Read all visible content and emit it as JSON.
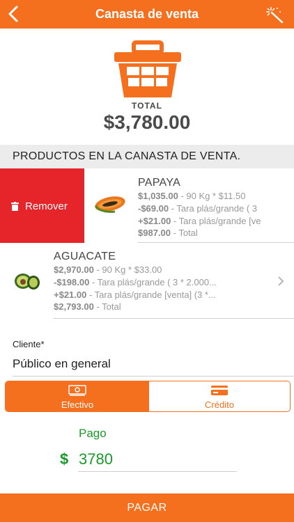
{
  "header": {
    "title": "Canasta de venta",
    "back_icon": "back-arrow-icon",
    "action_icon": "magic-wand-icon"
  },
  "colors": {
    "accent": "#f5701e",
    "danger": "#e6252a",
    "success": "#1a9a2a"
  },
  "summary": {
    "total_label": "TOTAL",
    "total_value": "$3,780.00"
  },
  "section_title": "PRODUCTOS EN LA CANASTA DE VENTA.",
  "products": [
    {
      "name": "PAPAYA",
      "remove_label": "Remover",
      "lines": [
        {
          "amount": "$1,035.00",
          "detail": " - 90 Kg * $11.50"
        },
        {
          "amount": "-$69.00",
          "detail": " - Tara plás/grande ( 3"
        },
        {
          "amount": "+$21.00",
          "detail": " - Tara plás/grande [ve"
        },
        {
          "amount": "$987.00",
          "detail": " - Total"
        }
      ]
    },
    {
      "name": "AGUACATE",
      "lines": [
        {
          "amount": "$2,970.00",
          "detail": " - 90 Kg * $33.00"
        },
        {
          "amount": "-$198.00",
          "detail": " - Tara plás/grande ( 3 * 2.000..."
        },
        {
          "amount": "+$21.00",
          "detail": " - Tara plás/grande [venta] (3 *..."
        },
        {
          "amount": "$2,793.00",
          "detail": " - Total"
        }
      ]
    }
  ],
  "client": {
    "label": "Cliente*",
    "value": "Público en general"
  },
  "payment_methods": [
    {
      "label": "Efectivo",
      "selected": true,
      "icon": "cash-icon"
    },
    {
      "label": "Crédito",
      "selected": false,
      "icon": "credit-card-icon"
    }
  ],
  "payment": {
    "label": "Pago",
    "currency": "$",
    "value": "3780"
  },
  "pay_button": "PAGAR"
}
